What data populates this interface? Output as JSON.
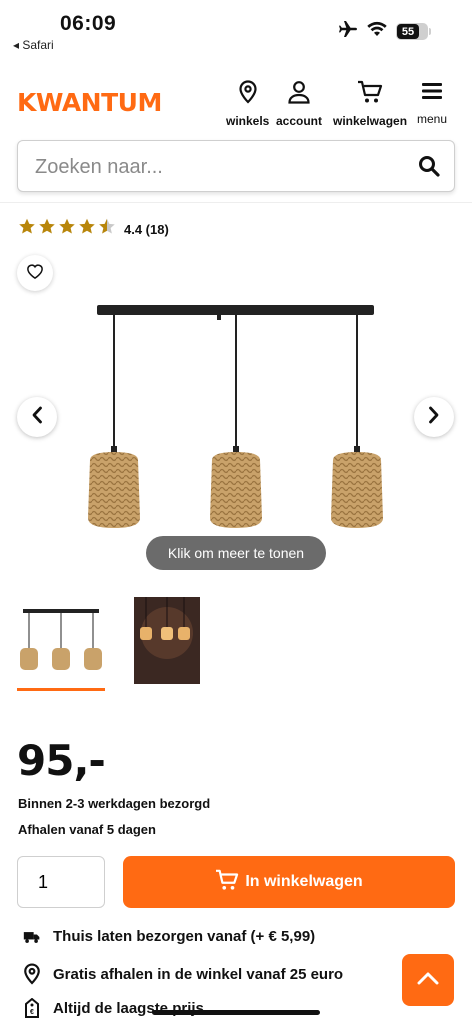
{
  "status": {
    "time": "06:09",
    "back_app": "◂ Safari",
    "battery": "55"
  },
  "header": {
    "logo": "KWANTUM",
    "nav": [
      {
        "label": "winkels",
        "icon": "location-pin-icon"
      },
      {
        "label": "account",
        "icon": "user-icon"
      },
      {
        "label": "winkelwagen",
        "icon": "cart-icon"
      },
      {
        "label": "menu",
        "icon": "hamburger-icon"
      }
    ]
  },
  "search": {
    "placeholder": "Zoeken naar..."
  },
  "product": {
    "rating_text": "4.4 (18)",
    "rating_value": 4.4,
    "tooltip": "Klik om meer te tonen",
    "price": "95,-",
    "delivery_time": "Binnen 2-3 werkdagen bezorgd",
    "pickup_time": "Afhalen vanaf 5 dagen",
    "quantity": "1",
    "add_to_cart": "In winkelwagen"
  },
  "usps": [
    {
      "text": "Thuis laten bezorgen vanaf (+ € 5,99)",
      "icon": "truck-icon"
    },
    {
      "text": "Gratis afhalen in de winkel vanaf 25 euro",
      "icon": "location-pin-icon"
    },
    {
      "text": "Altijd de laagste prijs",
      "icon": "price-tag-icon"
    }
  ],
  "colors": {
    "accent": "#ff6a13",
    "star": "#b8860b"
  }
}
